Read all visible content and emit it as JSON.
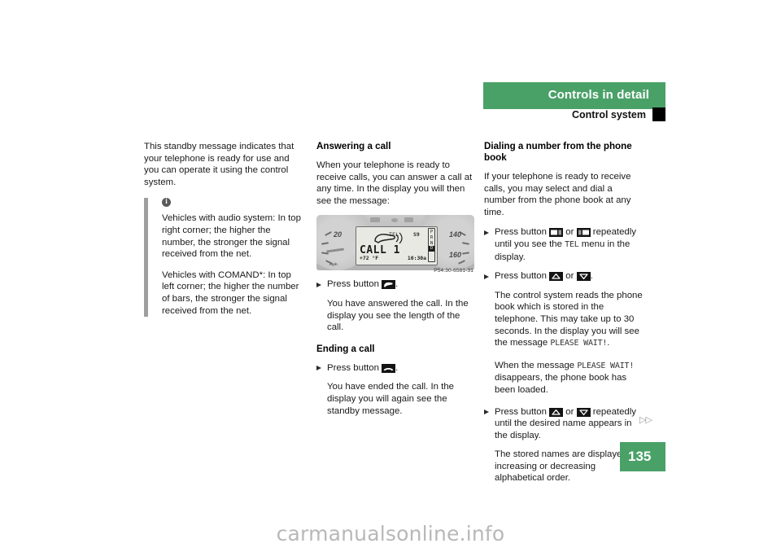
{
  "header": {
    "title": "Controls in detail",
    "subtitle": "Control system"
  },
  "left_column": {
    "intro": "This standby message indicates that your telephone is ready for use and you can operate it using the control system.",
    "note": {
      "icon": "info-icon",
      "paragraph_1": "Vehicles with audio system: In top right corner; the higher the number, the stronger the signal received from the net.",
      "paragraph_2": "Vehicles with COMAND*: In top left corner; the higher the number of bars, the stronger the signal received from the net."
    }
  },
  "middle_column": {
    "heading_answering": "Answering a call",
    "answering_intro": "When your telephone is ready to receive calls, you can answer a call at any time. In the display you will then see the message:",
    "figure": {
      "caption": "P54.30-6581-31",
      "lcd": {
        "tel_label": "TEL",
        "signal": "S9",
        "message": "CALL 1",
        "temperature": "+72 °F",
        "time": "10:30a",
        "gear_letters": "PRND",
        "gear_selected": "D"
      },
      "dial_left_number": "20",
      "dial_right_numbers": [
        "140",
        "160"
      ],
      "unit_label": "mph"
    },
    "answer_bullet_pre": "Press button",
    "answer_bullet_post": ".",
    "answer_bullet_icon": "phone-offhook-icon",
    "answer_result": "You have answered the call. In the display you see the length of the call.",
    "heading_ending": "Ending a call",
    "end_bullet_pre": "Press button",
    "end_bullet_post": ".",
    "end_bullet_icon": "phone-onhook-icon",
    "end_result": "You have ended the call. In the display you will again see the standby message."
  },
  "right_column": {
    "heading": "Dialing a number from the phone book",
    "intro": "If your telephone is ready to receive calls, you may select and dial a number from the phone book at any time.",
    "bullet_1": {
      "pre": "Press button",
      "icon_left": "menu-left-icon",
      "or": "or",
      "icon_right": "menu-right-icon",
      "post": "repeatedly until you see the",
      "mono": "TEL",
      "tail": "menu in the display."
    },
    "bullet_2": {
      "pre": "Press button",
      "icon_up": "arrow-up-icon",
      "or": "or",
      "icon_down": "arrow-down-icon",
      "post": "."
    },
    "result_2_a": "The control system reads the phone book which is stored in the telephone. This may take up to 30 seconds. In the display you will see the message",
    "result_2_mono": "PLEASE WAIT!",
    "result_2_b": ".",
    "result_3_pre": "When the message",
    "result_3_mono": "PLEASE WAIT!",
    "result_3_post": "disappears, the phone book has been loaded.",
    "bullet_3": {
      "pre": "Press button",
      "icon_up": "arrow-up-icon",
      "or": "or",
      "icon_down": "arrow-down-icon",
      "post": "repeatedly until the desired name appears in the display."
    },
    "result_4": "The stored names are displayed in increasing or decreasing alphabetical order."
  },
  "footer": {
    "page_number": "135",
    "continuation_marks": "▷▷",
    "watermark": "carmanualsonline.info"
  },
  "colors": {
    "accent_green": "#4aa168",
    "header_text": "#ffffff",
    "body_text": "#1a1a1a",
    "note_rule": "#9e9e9e",
    "watermark": "#b8b8b8"
  }
}
